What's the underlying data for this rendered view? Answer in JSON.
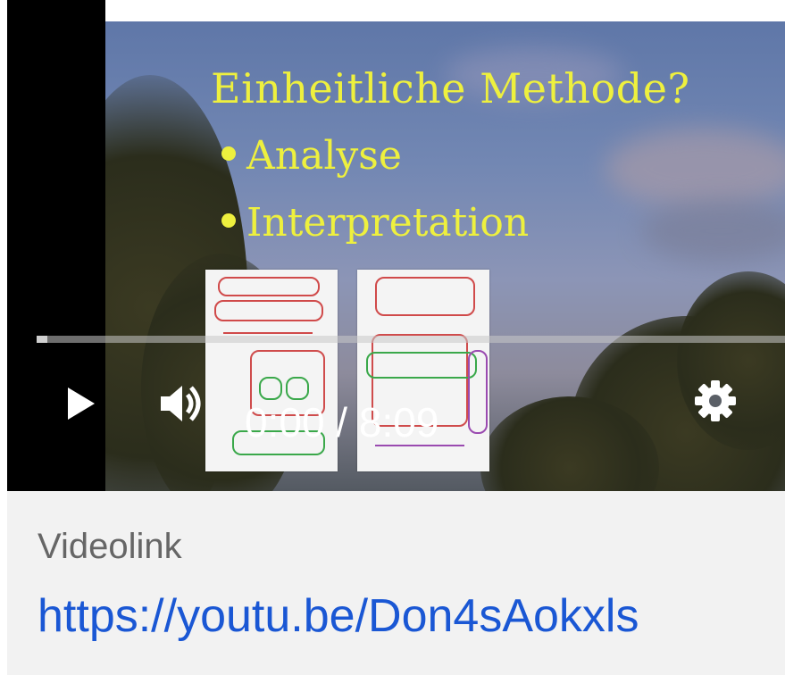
{
  "video": {
    "slide": {
      "title": "Einheitliche Methode?",
      "bullets": [
        "Analyse",
        "Interpretation"
      ]
    },
    "progress": 0.0,
    "time_display": "0:00 / 8:09",
    "icons": {
      "play": "play-icon",
      "volume": "volume-icon",
      "settings": "gear-icon"
    }
  },
  "caption": {
    "label": "Videolink",
    "link_text": "https://youtu.be/Don4sAokxls"
  },
  "colors": {
    "slide_text": "#eef03e",
    "link": "#1a57d4",
    "caption": "#666666"
  }
}
